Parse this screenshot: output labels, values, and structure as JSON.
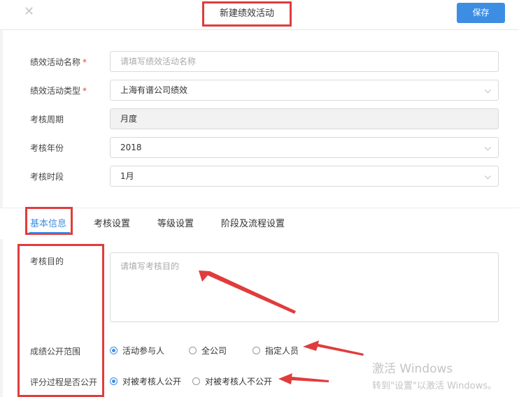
{
  "header": {
    "close_icon": "close-icon",
    "title": "新建绩效活动",
    "save_label": "保存"
  },
  "form": {
    "name": {
      "label": "绩效活动名称",
      "required": "*",
      "placeholder": "请填写绩效活动名称"
    },
    "type": {
      "label": "绩效活动类型",
      "required": "*",
      "value": "上海有谱公司绩效"
    },
    "cycle": {
      "label": "考核周期",
      "value": "月度"
    },
    "year": {
      "label": "考核年份",
      "value": "2018"
    },
    "period": {
      "label": "考核时段",
      "value": "1月"
    }
  },
  "tabs": [
    "基本信息",
    "考核设置",
    "等级设置",
    "阶段及流程设置"
  ],
  "basic": {
    "purpose": {
      "label": "考核目的",
      "placeholder": "请填写考核目的"
    },
    "scope": {
      "label": "成绩公开范围",
      "options": [
        "活动参与人",
        "全公司",
        "指定人员"
      ],
      "selected": "活动参与人"
    },
    "process": {
      "label": "评分过程是否公开",
      "options": [
        "对被考核人公开",
        "对被考核人不公开"
      ],
      "selected": "对被考核人公开"
    }
  },
  "watermark": {
    "line1": "激活 Windows",
    "line2": "转到\"设置\"以激活 Windows。"
  },
  "colors": {
    "accent": "#3d8ee3",
    "annotation": "#e03c3c"
  }
}
